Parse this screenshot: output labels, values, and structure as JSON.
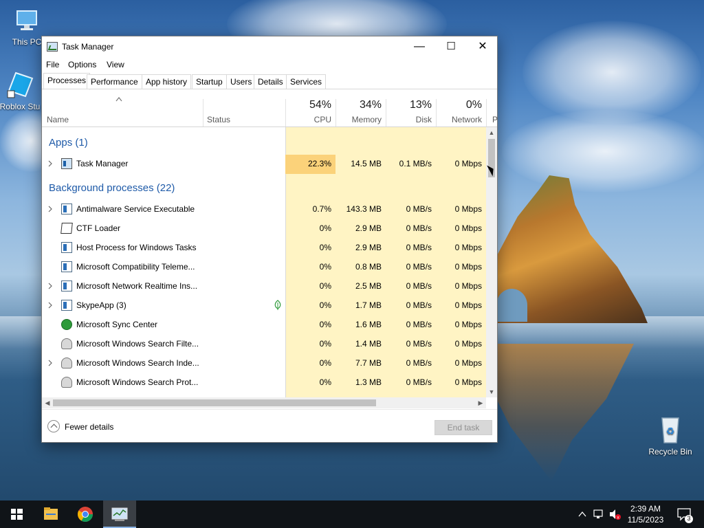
{
  "desktop": {
    "icons": [
      {
        "label": "This PC"
      },
      {
        "label": "Roblox Stu"
      },
      {
        "label": "Recycle Bin"
      }
    ]
  },
  "window": {
    "title": "Task Manager",
    "controls": {
      "minimize": "—",
      "maximize": "☐",
      "close": "✕"
    },
    "menu": [
      "File",
      "Options",
      "View"
    ],
    "tabs": [
      "Processes",
      "Performance",
      "App history",
      "Startup",
      "Users",
      "Details",
      "Services"
    ],
    "active_tab": "Processes"
  },
  "columns": {
    "name": "Name",
    "status": "Status",
    "cpu": {
      "pct": "54%",
      "label": "CPU"
    },
    "memory": {
      "pct": "34%",
      "label": "Memory"
    },
    "disk": {
      "pct": "13%",
      "label": "Disk"
    },
    "network": {
      "pct": "0%",
      "label": "Network"
    },
    "power": "P"
  },
  "groups": {
    "apps": "Apps (1)",
    "background": "Background processes (22)"
  },
  "apps": [
    {
      "name": "Task Manager",
      "cpu": "22.3%",
      "memory": "14.5 MB",
      "disk": "0.1 MB/s",
      "network": "0 Mbps",
      "expandable": true,
      "icon": "task-manager-icon"
    }
  ],
  "background": [
    {
      "name": "Antimalware Service Executable",
      "cpu": "0.7%",
      "memory": "143.3 MB",
      "disk": "0 MB/s",
      "network": "0 Mbps",
      "expandable": true,
      "icon": "service-icon"
    },
    {
      "name": "CTF Loader",
      "cpu": "0%",
      "memory": "2.9 MB",
      "disk": "0 MB/s",
      "network": "0 Mbps",
      "expandable": false,
      "icon": "ctf-icon"
    },
    {
      "name": "Host Process for Windows Tasks",
      "cpu": "0%",
      "memory": "2.9 MB",
      "disk": "0 MB/s",
      "network": "0 Mbps",
      "expandable": false,
      "icon": "service-icon"
    },
    {
      "name": "Microsoft Compatibility Teleme...",
      "cpu": "0%",
      "memory": "0.8 MB",
      "disk": "0 MB/s",
      "network": "0 Mbps",
      "expandable": false,
      "icon": "service-icon"
    },
    {
      "name": "Microsoft Network Realtime Ins...",
      "cpu": "0%",
      "memory": "2.5 MB",
      "disk": "0 MB/s",
      "network": "0 Mbps",
      "expandable": true,
      "icon": "service-icon"
    },
    {
      "name": "SkypeApp (3)",
      "cpu": "0%",
      "memory": "1.7 MB",
      "disk": "0 MB/s",
      "network": "0 Mbps",
      "expandable": true,
      "icon": "service-icon",
      "suspended": true
    },
    {
      "name": "Microsoft Sync Center",
      "cpu": "0%",
      "memory": "1.6 MB",
      "disk": "0 MB/s",
      "network": "0 Mbps",
      "expandable": false,
      "icon": "sync-icon"
    },
    {
      "name": "Microsoft Windows Search Filte...",
      "cpu": "0%",
      "memory": "1.4 MB",
      "disk": "0 MB/s",
      "network": "0 Mbps",
      "expandable": false,
      "icon": "search-indexer-icon"
    },
    {
      "name": "Microsoft Windows Search Inde...",
      "cpu": "0%",
      "memory": "7.7 MB",
      "disk": "0 MB/s",
      "network": "0 Mbps",
      "expandable": true,
      "icon": "search-indexer-icon"
    },
    {
      "name": "Microsoft Windows Search Prot...",
      "cpu": "0%",
      "memory": "1.3 MB",
      "disk": "0 MB/s",
      "network": "0 Mbps",
      "expandable": false,
      "icon": "search-indexer-icon"
    }
  ],
  "footer": {
    "fewer_details": "Fewer details",
    "end_task": "End task"
  },
  "taskbar": {
    "time": "2:39 AM",
    "date": "11/5/2023",
    "notifications": "3"
  },
  "colors": {
    "group_blue": "#1e5aa8",
    "cpu_hot": "#fbd27a",
    "heat_light": "#fff4c4",
    "heat_mid": "#feeeb0"
  }
}
